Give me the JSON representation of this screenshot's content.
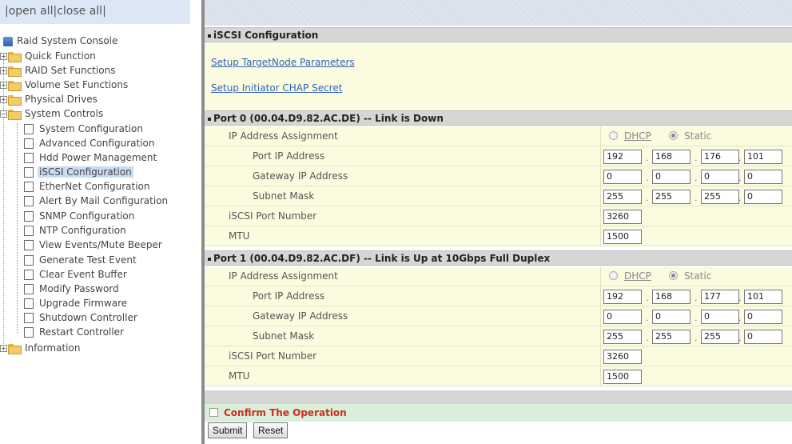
{
  "tree": {
    "open_all": "open all",
    "close_all": "close all",
    "separator": "|",
    "root": "Raid System Console",
    "folders": [
      "Quick Function",
      "RAID Set Functions",
      "Volume Set Functions",
      "Physical Drives",
      "System Controls"
    ],
    "system_controls_items": [
      "System Configuration",
      "Advanced Configuration",
      "Hdd Power Management",
      "iSCSI Configuration",
      "EtherNet Configuration",
      "Alert By Mail Configuration",
      "SNMP Configuration",
      "NTP Configuration",
      "View Events/Mute Beeper",
      "Generate Test Event",
      "Clear Event Buffer",
      "Modify Password",
      "Upgrade Firmware",
      "Shutdown Controller",
      "Restart Controller"
    ],
    "last_folder": "Information",
    "selected": "iSCSI Configuration"
  },
  "main": {
    "section_title": "iSCSI Configuration",
    "link_target": "Setup TargetNode Parameters",
    "link_chap": "Setup Initiator CHAP Secret",
    "labels": {
      "ip_assignment": "IP Address Assignment",
      "port_ip": "Port IP Address",
      "gateway_ip": "Gateway IP Address",
      "subnet": "Subnet Mask",
      "iscsi_port": "iSCSI Port Number",
      "mtu": "MTU",
      "dhcp": "DHCP",
      "static": "Static"
    },
    "ports": [
      {
        "header": "Port 0 (00.04.D9.82.AC.DE) -- Link is Down",
        "mode": "Static",
        "ip": [
          "192",
          "168",
          "176",
          "101"
        ],
        "gateway": [
          "0",
          "0",
          "0",
          "0"
        ],
        "subnet": [
          "255",
          "255",
          "255",
          "0"
        ],
        "iscsi_port": "3260",
        "mtu": "1500"
      },
      {
        "header": "Port 1 (00.04.D9.82.AC.DF) -- Link is Up at 10Gbps Full Duplex",
        "mode": "Static",
        "ip": [
          "192",
          "168",
          "177",
          "101"
        ],
        "gateway": [
          "0",
          "0",
          "0",
          "0"
        ],
        "subnet": [
          "255",
          "255",
          "255",
          "0"
        ],
        "iscsi_port": "3260",
        "mtu": "1500"
      }
    ],
    "confirm_label": "Confirm The Operation",
    "confirm_checked": false,
    "submit_label": "Submit",
    "reset_label": "Reset"
  },
  "colors": {
    "panel": "#fbfbe0",
    "header": "#d6d6d6",
    "link": "#2f63b8",
    "confirm_text": "#d12a1e",
    "confirm_bg": "#d9efd9",
    "selection": "#c9dcf2"
  }
}
